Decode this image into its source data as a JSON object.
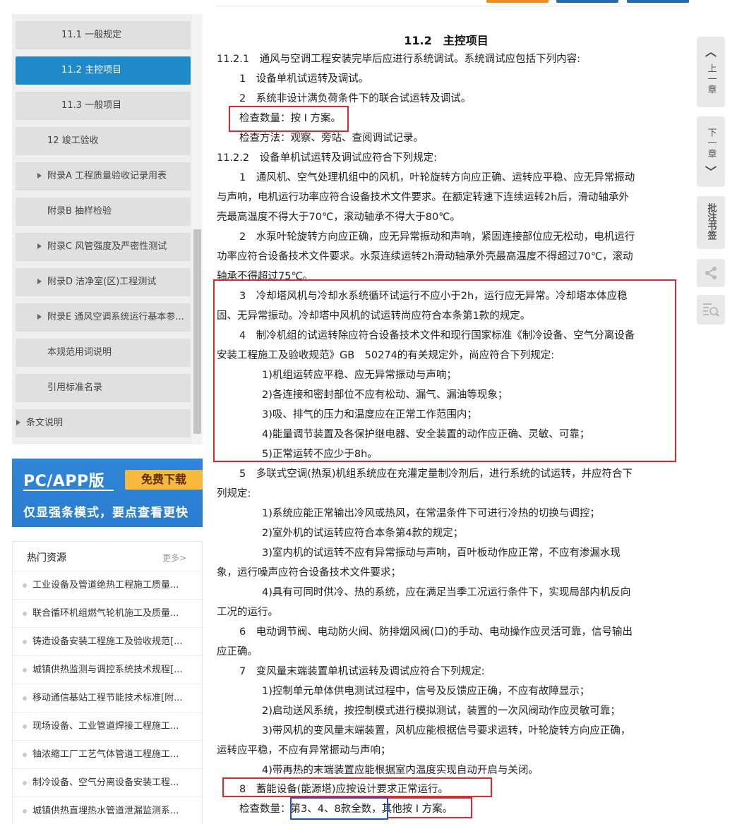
{
  "sidebar": {
    "items": [
      {
        "label": "11.1 一般规定",
        "level": 2,
        "active": false,
        "expandable": false
      },
      {
        "label": "11.2 主控项目",
        "level": 2,
        "active": true,
        "expandable": false
      },
      {
        "label": "11.3 一般项目",
        "level": 2,
        "active": false,
        "expandable": false
      },
      {
        "label": "12 竣工验收",
        "level": 1,
        "active": false,
        "expandable": false
      },
      {
        "label": "附录A 工程质量验收记录用表",
        "level": 1,
        "active": false,
        "expandable": true
      },
      {
        "label": "附录B 抽样检验",
        "level": 1,
        "active": false,
        "expandable": false
      },
      {
        "label": "附录C 风管强度及严密性测试",
        "level": 1,
        "active": false,
        "expandable": true
      },
      {
        "label": "附录D 洁净室(区)工程测试",
        "level": 1,
        "active": false,
        "expandable": true
      },
      {
        "label": "附录E 通风空调系统运行基本参...",
        "level": 1,
        "active": false,
        "expandable": true
      },
      {
        "label": "本规范用词说明",
        "level": 1,
        "active": false,
        "expandable": false
      },
      {
        "label": "引用标准名录",
        "level": 1,
        "active": false,
        "expandable": false
      },
      {
        "label": "条文说明",
        "level": 0,
        "active": false,
        "expandable": true
      }
    ]
  },
  "banner": {
    "platform": "PC/APP版",
    "download_label": "免费下载",
    "slogan": "仅显强条模式，要点查看更快"
  },
  "hot_resources": {
    "title": "热门资源",
    "more_label": "更多>",
    "items": [
      "工业设备及管道绝热工程施工质量...",
      "联合循环机组燃气轮机施工及质量...",
      "铸造设备安装工程施工及验收规范[...",
      "城镇供热监测与调控系统技术规程[...",
      "移动通信基站工程节能技术标准[附...",
      "现场设备、工业管道焊接工程施工...",
      "铀浓缩工厂工艺气体管道工程施工...",
      "制冷设备、空气分离设备安装工程...",
      "城镇供热直埋热水管道泄漏监测系..."
    ]
  },
  "right_tools": {
    "prev_label": "上一章",
    "next_label": "下一章",
    "bookmark_label": "批注书签",
    "share_icon": "share-icon",
    "search_icon": "search-text-icon"
  },
  "content": {
    "heading": "11.2　主控项目",
    "lines": [
      "11.2.1　通风与空调工程安装完毕后应进行系统调试。系统调试应包括下列内容:",
      "1　设备单机试运转及调试。",
      "2　系统非设计满负荷条件下的联合试运转及调试。",
      "检查数量：按 I 方案。",
      "检查方法：观察、旁站、查阅调试记录。",
      "11.2.2　设备单机试运转及调试应符合下列规定:",
      "1　通风机、空气处理机组中的风机，叶轮旋转方向应正确、运转应平稳、应无异常振动",
      "与声响，电机运行功率应符合设备技术文件要求。在额定转速下连续运转2h后，滑动轴承外",
      "壳最高温度不得大于70℃，滚动轴承不得大于80℃。",
      "2　水泵叶轮旋转方向应正确，应无异常振动和声响，紧固连接部位应无松动，电机运行",
      "功率应符合设备技术文件要求。水泵连续运转2h滑动轴承外壳最高温度不得超过70℃，滚动",
      "轴承不得超过75℃。",
      "3　冷却塔风机与冷却水系统循环试运行不应小于2h，运行应无异常。冷却塔本体应稳",
      "固、无异常振动。冷却塔中风机的试运转尚应符合本条第1款的规定。",
      "4　制冷机组的试运转除应符合设备技术文件和现行国家标准《制冷设备、空气分离设备",
      "安装工程施工及验收规范》GB　50274的有关规定外，尚应符合下列规定:",
      "1)机组运转应平稳、应无异常振动与声响；",
      "2)各连接和密封部位不应有松动、漏气、漏油等现象；",
      "3)吸、排气的压力和温度应在正常工作范围内；",
      "4)能量调节装置及各保护继电器、安全装置的动作应正确、灵敏、可靠；",
      "5)正常运转不应少于8h。",
      "5　多联式空调(热泵)机组系统应在充灌定量制冷剂后，进行系统的试运转，并应符合下",
      "列规定:",
      "1)系统应能正常输出冷风或热风，在常温条件下可进行冷热的切换与调控；",
      "2)室外机的试运转应符合本条第4款的规定；",
      "3)室内机的试运转不应有异常振动与声响，百叶板动作应正常，不应有渗漏水现",
      "象，运行噪声应符合设备技术文件要求；",
      "4)具有可同时供冷、热的系统，应在满足当季工况运行条件下，实现局部内机反向",
      "工况的运行。",
      "6　电动调节阀、电动防火阀、防排烟风阀(口)的手动、电动操作应灵活可靠，信号输出",
      "应正确。",
      "7　变风量末端装置单机试运转及调试应符合下列规定:",
      "1)控制单元单体供电测试过程中，信号及反馈应正确，不应有故障显示；",
      "2)启动送风系统，按控制模式进行模拟测试，装置的一次风阀动作应灵敏可靠；",
      "3)带风机的变风量末端装置，风机应能根据信号要求运转，叶轮旋转方向应正确，",
      "运转应平稳，不应有异常振动与声响；",
      "4)带再热的末端装置应能根据室内温度实现自动开启与关闭。",
      "8　蓄能设备(能源塔)应按设计要求正常运行。",
      "检查数量：第3、4、8款全数，其他按 I 方案。"
    ]
  }
}
